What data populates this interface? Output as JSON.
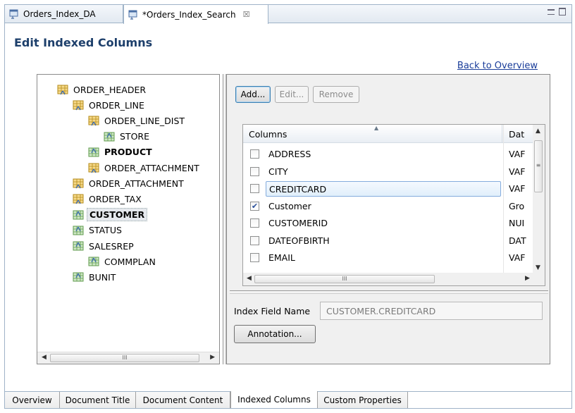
{
  "editor_tabs": [
    {
      "label": "Orders_Index_DA",
      "active": false
    },
    {
      "label": "*Orders_Index_Search",
      "active": true,
      "close_glyph": "☒"
    }
  ],
  "page": {
    "title": "Edit Indexed Columns",
    "back_link": "Back to Overview"
  },
  "tree": {
    "items": [
      {
        "label": "ORDER_HEADER",
        "icon": "table-parent-icon"
      },
      {
        "label": "ORDER_LINE",
        "icon": "table-parent-icon"
      },
      {
        "label": "ORDER_LINE_DIST",
        "icon": "table-parent-icon"
      },
      {
        "label": "STORE",
        "icon": "table-child-icon"
      },
      {
        "label": "PRODUCT",
        "icon": "table-child-icon",
        "bold": true
      },
      {
        "label": "ORDER_ATTACHMENT",
        "icon": "table-parent-icon"
      },
      {
        "label": "ORDER_ATTACHMENT",
        "icon": "table-parent-icon"
      },
      {
        "label": "ORDER_TAX",
        "icon": "table-parent-icon"
      },
      {
        "label": "CUSTOMER",
        "icon": "table-child-icon",
        "bold": true,
        "selected": true
      },
      {
        "label": "STATUS",
        "icon": "table-child-icon"
      },
      {
        "label": "SALESREP",
        "icon": "table-child-icon"
      },
      {
        "label": "COMMPLAN",
        "icon": "table-child-icon"
      },
      {
        "label": "BUNIT",
        "icon": "table-child-icon"
      }
    ],
    "scroll_thumb_glyph": "III"
  },
  "toolbar": {
    "add_label": "Add...",
    "edit_label": "Edit...",
    "remove_label": "Remove"
  },
  "columns_table": {
    "headers": [
      "Columns",
      "Dat"
    ],
    "rows": [
      {
        "name": "ADDRESS",
        "type": "VAF",
        "checked": false
      },
      {
        "name": "CITY",
        "type": "VAF",
        "checked": false
      },
      {
        "name": "CREDITCARD",
        "type": "VAF",
        "checked": false,
        "highlighted": true
      },
      {
        "name": "Customer",
        "type": "Gro",
        "checked": true
      },
      {
        "name": "CUSTOMERID",
        "type": "NUI",
        "checked": false
      },
      {
        "name": "DATEOFBIRTH",
        "type": "DAT",
        "checked": false
      },
      {
        "name": "EMAIL",
        "type": "VAF",
        "checked": false
      }
    ],
    "scroll_thumb_glyph": "III"
  },
  "index_field": {
    "label": "Index Field Name",
    "value": "CUSTOMER.CREDITCARD"
  },
  "annotation_label": "Annotation...",
  "page_tabs": [
    {
      "label": "Overview"
    },
    {
      "label": "Document Title"
    },
    {
      "label": "Document Content"
    },
    {
      "label": "Indexed Columns",
      "active": true
    },
    {
      "label": "Custom Properties"
    }
  ],
  "colors": {
    "title": "#1d3f6b",
    "link": "#1a3d9a",
    "highlight_border": "#84acdd"
  }
}
